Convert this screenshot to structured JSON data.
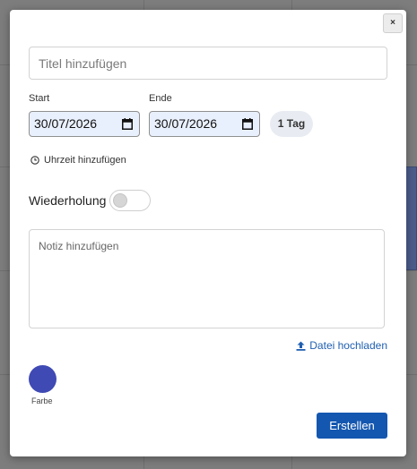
{
  "dialog": {
    "close_label": "×",
    "title_placeholder": "Titel hinzufügen",
    "start": {
      "label": "Start",
      "value": "30/07/2026"
    },
    "end": {
      "label": "Ende",
      "value": "30/07/2026"
    },
    "duration_badge": "1 Tag",
    "add_time_label": "Uhrzeit hinzufügen",
    "repeat": {
      "label": "Wiederholung",
      "enabled": false
    },
    "note_placeholder": "Notiz hinzufügen",
    "upload_label": "Datei hochladen",
    "color": {
      "label": "Farbe",
      "value": "#3f4ab4"
    },
    "create_label": "Erstellen"
  },
  "colors": {
    "primary": "#1457b0",
    "link": "#1f5fb0",
    "date_bg": "#e9f0fd"
  },
  "icons": {
    "close": "close-icon",
    "calendar": "calendar-icon",
    "clock": "clock-icon",
    "upload": "upload-icon"
  }
}
